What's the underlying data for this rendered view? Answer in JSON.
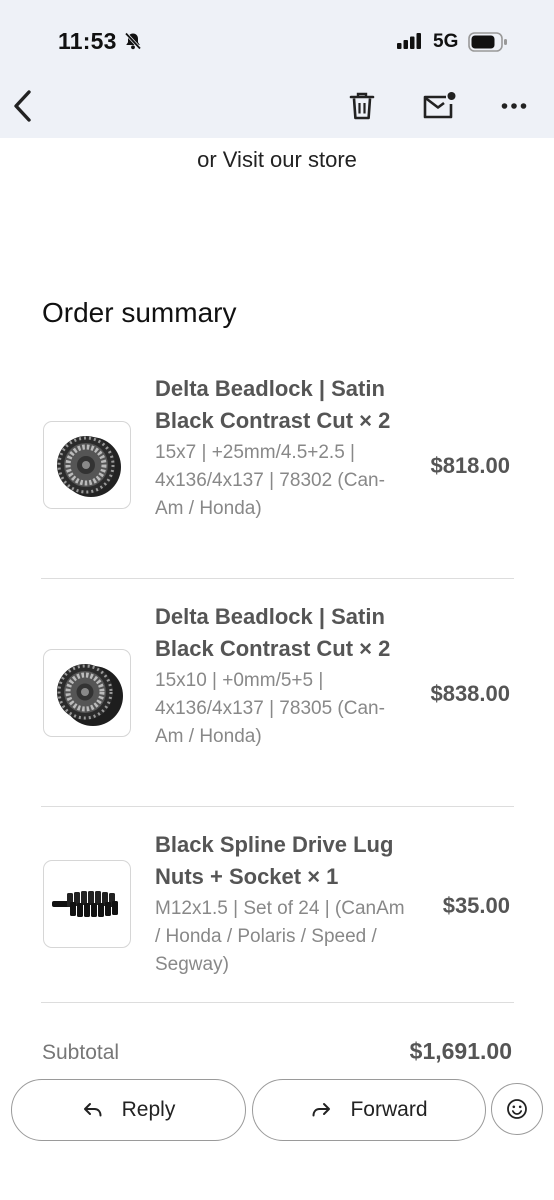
{
  "status_bar": {
    "time": "11:53",
    "network": "5G"
  },
  "toolbar": {
    "back_icon": "chevron-left",
    "delete_icon": "trash",
    "mark_unread_icon": "mail-dot",
    "more_icon": "more-horizontal"
  },
  "email": {
    "store_line": "or Visit our store",
    "summary_title": "Order summary",
    "items": [
      {
        "name": "Delta Beadlock | Satin Black Contrast Cut × 2",
        "specs": "15x7 | +25mm/4.5+2.5 | 4x136/4x137 | 78302 (Can-Am / Honda)",
        "price": "$818.00",
        "image": "beadlock-wheel"
      },
      {
        "name": "Delta Beadlock | Satin Black Contrast Cut × 2",
        "specs": "15x10 | +0mm/5+5 | 4x136/4x137 | 78305 (Can-Am / Honda)",
        "price": "$838.00",
        "image": "beadlock-wheel"
      },
      {
        "name": "Black Spline Drive Lug Nuts + Socket × 1",
        "specs": "M12x1.5 | Set of 24 | (CanAm / Honda / Polaris / Speed / Segway)",
        "price": "$35.00",
        "image": "lug-nuts"
      }
    ],
    "subtotal_label": "Subtotal",
    "subtotal_value": "$1,691.00"
  },
  "actions": {
    "reply_label": "Reply",
    "forward_label": "Forward",
    "emoji_icon": "smiley"
  }
}
